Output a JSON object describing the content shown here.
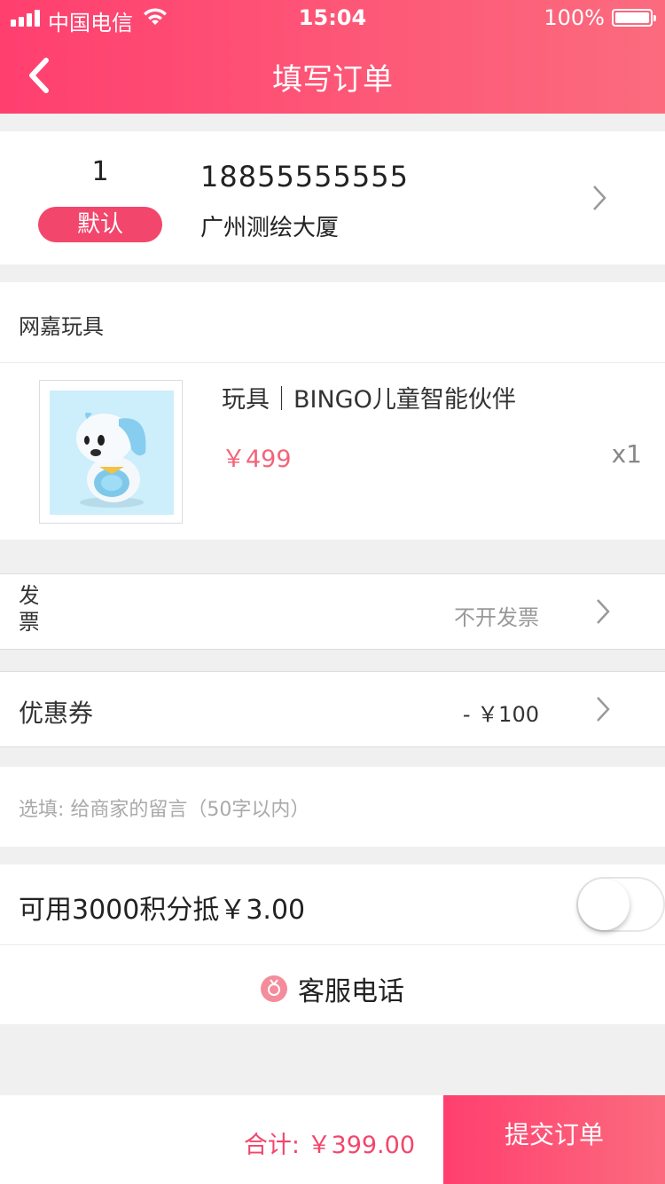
{
  "status_bar": {
    "carrier": "中国电信",
    "time": "15:04",
    "battery": "100%"
  },
  "header": {
    "title": "填写订单",
    "back_icon": "chevron-left-icon"
  },
  "address": {
    "index": "1",
    "default_badge": "默认",
    "phone": "18855555555",
    "location": "广州测绘大厦"
  },
  "shop": {
    "name": "网嘉玩具",
    "product": {
      "name": "玩具｜BINGO儿童智能伙伴",
      "price": "￥499",
      "quantity": "x1"
    }
  },
  "invoice": {
    "label": "发票",
    "value": "不开发票"
  },
  "coupon": {
    "label": "优惠券",
    "value": "- ￥100"
  },
  "note": {
    "placeholder": "选填:   给商家的留言（50字以内）"
  },
  "points": {
    "label": "可用3000积分抵￥3.00",
    "enabled": false
  },
  "service": {
    "label": "客服电话",
    "icon": "service-badge-icon"
  },
  "footer": {
    "total": "合计:  ￥399.00",
    "submit_label": "提交订单"
  },
  "colors": {
    "accent": "#f2466c",
    "header_start": "#ff3f6f",
    "header_end": "#fb6b7e",
    "price": "#f2657a"
  }
}
